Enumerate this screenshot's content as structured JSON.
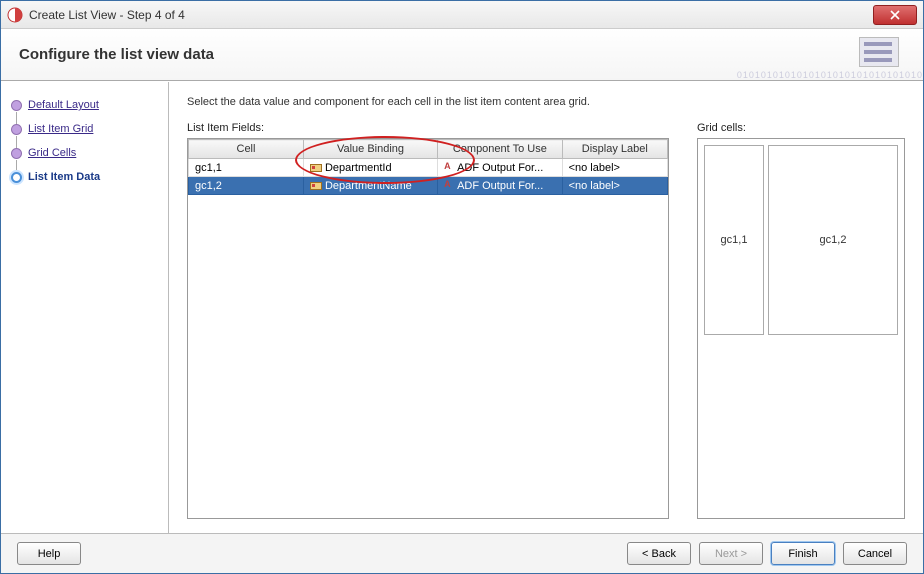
{
  "window": {
    "title": "Create List View - Step 4 of 4"
  },
  "banner": {
    "heading": "Configure the list view data"
  },
  "sidebar": {
    "steps": [
      {
        "label": "Default Layout"
      },
      {
        "label": "List Item Grid"
      },
      {
        "label": "Grid Cells"
      },
      {
        "label": "List Item Data"
      }
    ]
  },
  "content": {
    "instruction": "Select the data value and component for each cell in the list item content area grid.",
    "fields_label": "List Item Fields:",
    "grid_label": "Grid cells:",
    "columns": {
      "cell": "Cell",
      "binding": "Value Binding",
      "component": "Component To Use",
      "display": "Display Label"
    },
    "rows": [
      {
        "cell": "gc1,1",
        "binding": "DepartmentId",
        "component": "ADF Output For...",
        "display": "<no label>"
      },
      {
        "cell": "gc1,2",
        "binding": "DepartmentName",
        "component": "ADF Output For...",
        "display": "<no label>"
      }
    ],
    "grid_cells": [
      {
        "name": "gc1,1"
      },
      {
        "name": "gc1,2"
      }
    ]
  },
  "footer": {
    "help": "Help",
    "back": "< Back",
    "next": "Next >",
    "finish": "Finish",
    "cancel": "Cancel"
  }
}
